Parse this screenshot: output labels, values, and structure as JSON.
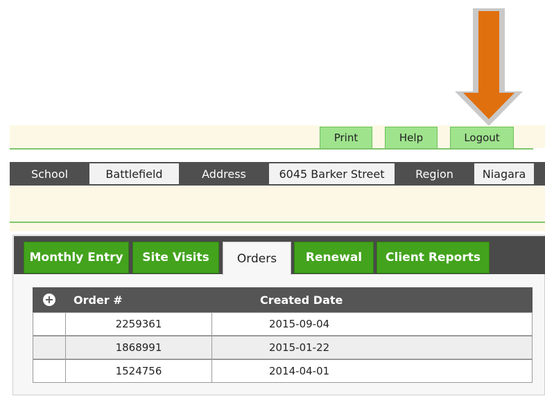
{
  "header_buttons": {
    "print": "Print",
    "help": "Help",
    "logout": "Logout"
  },
  "info": {
    "school_label": "School",
    "school_value": "Battlefield",
    "address_label": "Address",
    "address_value": "6045 Barker Street",
    "region_label": "Region",
    "region_value": "Niagara"
  },
  "tabs": [
    {
      "label": "Monthly Entry"
    },
    {
      "label": "Site Visits"
    },
    {
      "label": "Orders"
    },
    {
      "label": "Renewal"
    },
    {
      "label": "Client Reports"
    }
  ],
  "table": {
    "columns": [
      "Order #",
      "Created Date"
    ],
    "rows": [
      {
        "order": "2259361",
        "date": "2015-09-04"
      },
      {
        "order": "1868991",
        "date": "2015-01-22"
      },
      {
        "order": "1524756",
        "date": "2014-04-01"
      }
    ]
  },
  "colors": {
    "accent_green": "#43a31d",
    "arrow_orange": "#e0700e",
    "header_gray": "#4f4f4f"
  },
  "icons": {
    "annotation": "down-arrow-icon",
    "add": "plus-circle-icon"
  }
}
